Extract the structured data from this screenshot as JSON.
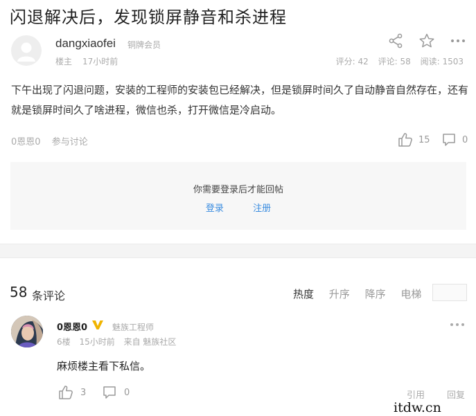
{
  "post": {
    "title": "闪退解决后，发现锁屏静音和杀进程",
    "author": "dangxiaofei",
    "badge": "铜牌会员",
    "floor": "楼主",
    "time": "17小时前",
    "stats": {
      "score": "评分: 42",
      "comments": "评论: 58",
      "reads": "阅读: 1503"
    },
    "body": "下午出现了闪退问题，安装的工程师的安装包已经解决，但是锁屏时间久了自动静音自然存在，还有就是锁屏时间久了啥进程，微信也杀，打开微信是冷启动。",
    "tags": [
      "0恩恩0",
      "参与讨论"
    ],
    "likes": "15",
    "comment_count": "0"
  },
  "login_prompt": {
    "text": "你需要登录后才能回帖",
    "login": "登录",
    "register": "注册"
  },
  "comments_header": {
    "count": "58",
    "label": "条评论",
    "sorts": [
      "热度",
      "升序",
      "降序",
      "电梯"
    ]
  },
  "comment": {
    "user": "0恩恩0",
    "title": "魅族工程师",
    "floor": "6楼",
    "time": "15小时前",
    "source": "来自 魅族社区",
    "text": "麻烦楼主看下私信。",
    "likes": "3",
    "replies": "0",
    "quote": "引用",
    "reply": "回复"
  },
  "watermark": "itdw.cn",
  "icons": [
    "share-icon",
    "star-icon",
    "more-icon",
    "thumbs-up-icon",
    "comment-icon",
    "verified-v-icon"
  ],
  "colors": {
    "link": "#3a8ce0",
    "muted": "#aaaaaa",
    "verified": "#f0b400"
  }
}
